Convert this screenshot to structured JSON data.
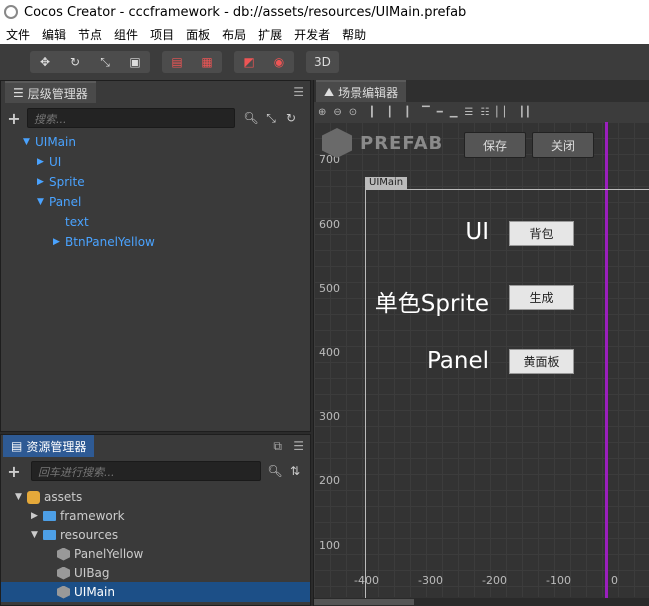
{
  "window": {
    "title": "Cocos Creator - cccframework - db://assets/resources/UIMain.prefab"
  },
  "menu": [
    "文件",
    "编辑",
    "节点",
    "组件",
    "项目",
    "面板",
    "布局",
    "扩展",
    "开发者",
    "帮助"
  ],
  "toolbar": {
    "btn3d": "3D"
  },
  "hierarchy": {
    "tab": "层级管理器",
    "search_placeholder": "搜索...",
    "nodes": [
      {
        "label": "UIMain",
        "depth": 0,
        "expanded": true
      },
      {
        "label": "UI",
        "depth": 1,
        "expanded": false
      },
      {
        "label": "Sprite",
        "depth": 1,
        "expanded": false
      },
      {
        "label": "Panel",
        "depth": 1,
        "expanded": true
      },
      {
        "label": "text",
        "depth": 2,
        "expanded": null
      },
      {
        "label": "BtnPanelYellow",
        "depth": 2,
        "expanded": false
      }
    ]
  },
  "assets": {
    "tab": "资源管理器",
    "search_placeholder": "回车进行搜索...",
    "items": [
      {
        "label": "assets",
        "type": "root"
      },
      {
        "label": "framework",
        "type": "folder"
      },
      {
        "label": "resources",
        "type": "folder"
      },
      {
        "label": "PanelYellow",
        "type": "prefab"
      },
      {
        "label": "UIBag",
        "type": "prefab"
      },
      {
        "label": "UIMain",
        "type": "prefab",
        "selected": true
      }
    ]
  },
  "scene": {
    "tab": "场景编辑器",
    "prefab_label": "PREFAB",
    "save": "保存",
    "close": "关闭",
    "canvas_label": "UIMain",
    "y_ticks": [
      "700",
      "600",
      "500",
      "400",
      "300",
      "200",
      "100"
    ],
    "x_ticks": [
      "-400",
      "-300",
      "-200",
      "-100",
      "0"
    ],
    "rows": [
      {
        "label": "UI",
        "button": "背包"
      },
      {
        "label": "单色Sprite",
        "button": "生成"
      },
      {
        "label": "Panel",
        "button": "黄面板"
      }
    ]
  },
  "colors": {
    "accent_blue": "#4aa3ff",
    "selection": "#1c4f87",
    "origin_line": "#9b1fbd"
  }
}
